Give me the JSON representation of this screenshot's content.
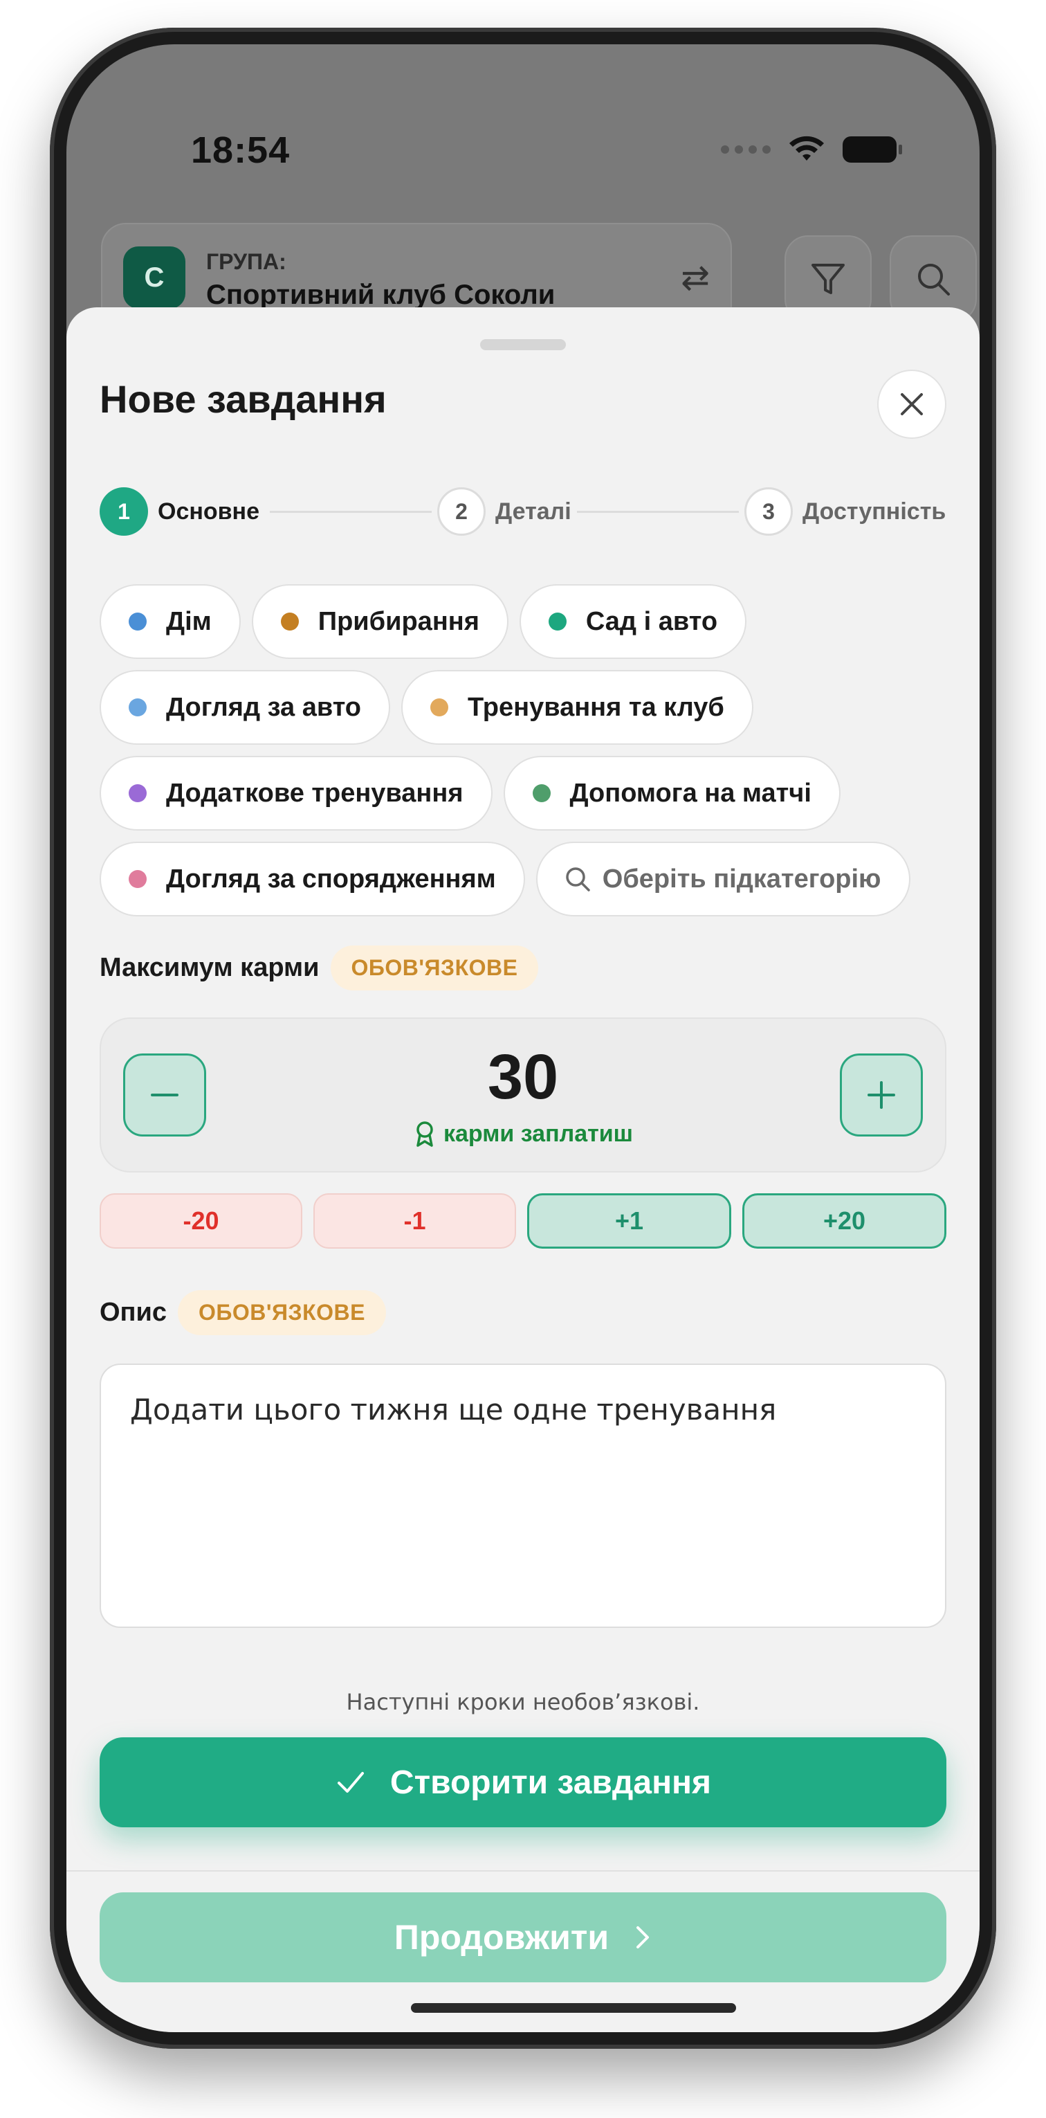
{
  "status_bar": {
    "time": "18:54"
  },
  "background": {
    "group_avatar": "С",
    "group_label": "ГРУПА:",
    "group_name": "Спортивний клуб Соколи",
    "icons": [
      "swap-icon",
      "filter-icon",
      "search-icon"
    ]
  },
  "sheet": {
    "title": "Нове завдання",
    "steps": [
      {
        "number": "1",
        "label": "Основне",
        "state": "active"
      },
      {
        "number": "2",
        "label": "Деталі",
        "state": "idle"
      },
      {
        "number": "3",
        "label": "Доступність",
        "state": "idle"
      }
    ],
    "categories": [
      {
        "label": "Дім",
        "color": "#4a8fd6"
      },
      {
        "label": "Прибирання",
        "color": "#c47f22"
      },
      {
        "label": "Сад і авто",
        "color": "#1da77f"
      },
      {
        "label": "Догляд за авто",
        "color": "#6aa6e0"
      },
      {
        "label": "Тренування та клуб",
        "color": "#e2a95c"
      },
      {
        "label": "Додаткове тренування",
        "color": "#9a6ad6"
      },
      {
        "label": "Допомога на матчі",
        "color": "#4f9e6b"
      },
      {
        "label": "Догляд за спорядженням",
        "color": "#e07c9c"
      }
    ],
    "subcategory_placeholder": "Оберіть підкатегорію",
    "karma": {
      "label": "Максимум карми",
      "badge": "ОБОВ'ЯЗКОВЕ",
      "value": "30",
      "caption": "карми заплатиш",
      "quick": [
        "-20",
        "-1",
        "+1",
        "+20"
      ]
    },
    "description": {
      "label": "Опис",
      "badge": "ОБОВ'ЯЗКОВЕ",
      "value": "Додати цього тижня ще одне тренування"
    },
    "hint": "Наступні кроки необов’язкові.",
    "create_label": "Створити завдання",
    "continue_label": "Продовжити"
  },
  "colors": {
    "accent": "#20ac85",
    "accent_light": "#8bd3b9",
    "required": "#c98a2b",
    "negative": "#e0302a"
  }
}
